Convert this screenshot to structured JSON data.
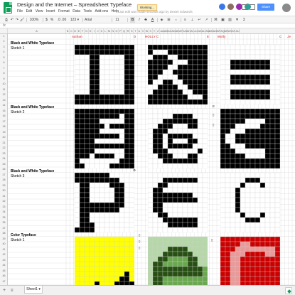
{
  "document": {
    "title": "Design and the Internet – Spreadsheet Typeface",
    "status_chip": "Working...",
    "last_edit": "Last edit was made seconds ago by Dexter Edwards",
    "share_label": "Share"
  },
  "menu": [
    "File",
    "Edit",
    "View",
    "Insert",
    "Format",
    "Data",
    "Tools",
    "Add-ons",
    "Help"
  ],
  "toolbar": {
    "zoom": "100%",
    "currency": "$",
    "percent": "%",
    "decimals": ".0  .00",
    "number_format": "123 ▾",
    "font": "Arial",
    "font_size": "11",
    "bold": "B",
    "italic": "I",
    "strike": "S",
    "text_color": "A"
  },
  "formula_bar": {
    "fx": "fx",
    "value": ""
  },
  "grid": {
    "columns": [
      "A",
      "B",
      "C",
      "D",
      "E",
      "F",
      "G",
      "H",
      "I",
      "J",
      "K",
      "L",
      "M",
      "N",
      "O",
      "P",
      "Q",
      "R",
      "S",
      "T",
      "U",
      "V",
      "W",
      "X",
      "Y",
      "Z",
      "AA",
      "AB",
      "AC",
      "AD",
      "AE",
      "AF",
      "AG",
      "AH",
      "AI",
      "AJ",
      "AK",
      "AL",
      "AM",
      "AN",
      "AO",
      "AP",
      "AQ",
      "AR",
      "AS",
      "AT",
      "AU"
    ],
    "rows": [
      "1",
      "2",
      "3",
      "4",
      "5",
      "6",
      "7",
      "8",
      "9",
      "10",
      "11",
      "12",
      "13",
      "14",
      "15",
      "16",
      "17",
      "18",
      "19",
      "20",
      "21",
      "22",
      "23",
      "24",
      "25",
      "26",
      "27",
      "28",
      "29",
      "30",
      "31",
      "32",
      "33",
      "34",
      "35",
      "36",
      "37",
      "38",
      "39",
      "40",
      "41",
      "42",
      "43",
      "44",
      "45",
      "46",
      "47",
      "48",
      "49",
      "50",
      "51"
    ],
    "header_row": [
      {
        "name": "nathan",
        "letter": "D"
      },
      {
        "name": "HOLLY C",
        "letter": "E"
      },
      {
        "name": "Molly",
        "letter": "C"
      }
    ],
    "header_extra": "Je",
    "side_marks": [
      "E",
      "▯",
      "▯",
      "▯",
      "▯",
      "▯",
      "▯"
    ]
  },
  "sections": [
    {
      "title": "Black and White Typeface",
      "subtitle": "Sketch 1"
    },
    {
      "title": "Black and White Typeface",
      "subtitle": "Sketch 2"
    },
    {
      "title": "Black and White Typeface",
      "subtitle": "Sketch 3"
    },
    {
      "title": "Color Typeface",
      "subtitle": "Sketch 1"
    }
  ],
  "bottom": {
    "add_sheet": "+",
    "sheets_menu": "≡",
    "sheet_tab": "Sheet1",
    "sheet_tab_arrow": "▾"
  },
  "colors": {
    "black": "#000000",
    "white": "#ffffff",
    "grid_line": "#d9d9d9",
    "yellow": "#ffff00",
    "green_dark": "#274e13",
    "green_mid": "#6aa84f",
    "green_light": "#b6d7a8",
    "red": "#cc0000",
    "pink": "#ea9999",
    "header_red": "#e06666",
    "sheets_green": "#0f9d58"
  },
  "glyphs": [
    [
      "111111111111",
      "111111111111",
      "000110000011",
      "000110000011",
      "000110000011",
      "000110000011",
      "000110000011",
      "000110000011",
      "000110000011",
      "000110000011",
      "111111111111",
      "111111111111"
    ],
    [
      "111111111111",
      "100011111111",
      "011100111111",
      "111110001111",
      "111100111111",
      "111001111111",
      "110000111111",
      "100110011111",
      "001111001111",
      "011111100111",
      "111111110001",
      "111111111111"
    ],
    [
      "000000000000",
      "000000000000",
      "000000000000",
      "001111111100",
      "001111111100",
      "000000000000",
      "001111111100",
      "001111111100",
      "000000000000",
      "001111111100",
      "001111111100",
      "000000000000"
    ],
    [
      "111111111111",
      "111111111011",
      "111110000011",
      "111111011111",
      "111110000011",
      "111111111011",
      "111100000011",
      "111111111111",
      "111100000011",
      "111011110011",
      "100000000111",
      "110000011111"
    ],
    [
      "000000000000",
      "000001111000",
      "000111111100",
      "001110001100",
      "011100000000",
      "011011111000",
      "011010001100",
      "011011111000",
      "011100000010",
      "001110001100",
      "000111111100",
      "000000000000"
    ],
    [
      "111111111111",
      "111111111111",
      "111110000111",
      "111000001111",
      "110001111111",
      "100111111111",
      "100111111111",
      "110001111111",
      "111000000111",
      "111110000111",
      "111111111111",
      "111111111111"
    ],
    [
      "111111100000",
      "111111111000",
      "011000011100",
      "011000001100",
      "011000001100",
      "011000001100",
      "011111111100",
      "011111111000",
      "011000000000",
      "011000000000",
      "011100000000",
      "111100000000"
    ],
    [
      "000000000000",
      "000111111100",
      "001100000000",
      "011000000000",
      "011111111000",
      "011111111100",
      "011000000000",
      "011000000000",
      "001100000000",
      "000111111100",
      "000011111100",
      "000000000000"
    ],
    [
      "000000000000",
      "000001110000",
      "000010001000",
      "000100000000",
      "000100000000",
      "000100000000",
      "000100000000",
      "000100000000",
      "000010001000",
      "000001110000",
      "000000000000",
      "000000000000"
    ],
    [
      "YYYYYYYYYYYY",
      "YYYYYYYYYYYY",
      "YYYYYYYYYYYY",
      "YYYYYYYYYYYY",
      "YYYYYYYYYYYY",
      "YYYYYYYYYYYY",
      "YYYYYYYYYYYY",
      "YYYYYYYYYYKY",
      "YYYYYYYYYKKY",
      "YYYYKYYYKKKK",
      "YYKKKKWKKKKK",
      "KKKWWWWWKKKK"
    ],
    [
      "LLLLLLLLLLLL",
      "LLLLLLLLLLLL",
      "LLLLDDDDLLLL",
      "LLLDDDDDDLLL",
      "LLDDMMMMDDLL",
      "LDDMMMMMDDLL",
      "LDDDDDDDDDDM",
      "LDDDDDDDDDDM",
      "LDDMMMMMMMMM",
      "LDDMMMMMMMMM",
      "LDDDMMMMMMMM",
      "LLDDDDDMMMMM"
    ],
    [
      "RRRRRRRRRRRR",
      "RRRRPPRRRRRR",
      "RRRPPPPPPPPR",
      "RRPPPRRRRPPR",
      "RRPPRRRRRRRR",
      "RRPPRRRRRRRR",
      "RRPPRRRRRRRR",
      "RRPPRRRRRRRR",
      "RRPPRRRRRRRR",
      "RRPPRRRRRRRR",
      "RRPPRRRRRRRR",
      "RRPPRRRRRRRR"
    ]
  ]
}
